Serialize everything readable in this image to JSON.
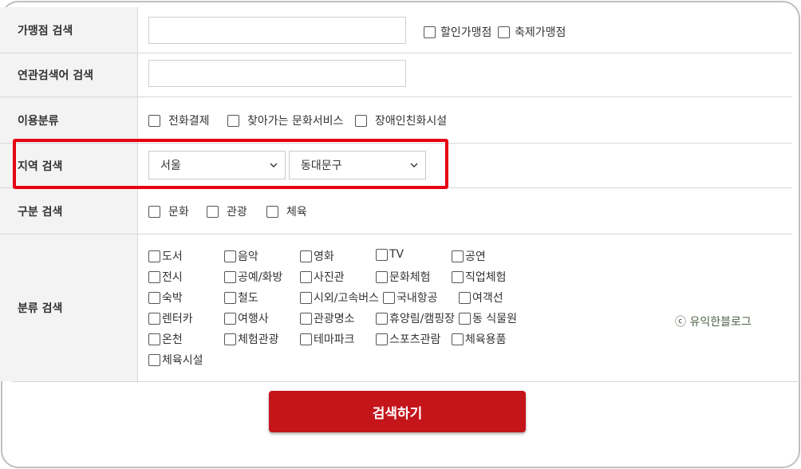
{
  "rows": {
    "merchant": {
      "label": "가맹점 검색",
      "checks": [
        "할인가맹점",
        "축제가맹점"
      ]
    },
    "keyword": {
      "label": "연관검색어 검색"
    },
    "usage": {
      "label": "이용분류",
      "checks": [
        "전화결제",
        "찾아가는 문화서비스",
        "장애인친화시설"
      ]
    },
    "region": {
      "label": "지역 검색",
      "city": "서울",
      "district": "동대문구"
    },
    "division": {
      "label": "구분 검색",
      "checks": [
        "문화",
        "관광",
        "체육"
      ]
    },
    "category": {
      "label": "분류 검색",
      "items": [
        "도서",
        "음악",
        "영화",
        "TV",
        "공연",
        "전시",
        "공예/화방",
        "사진관",
        "문화체험",
        "직업체험",
        "숙박",
        "철도",
        "시외/고속버스",
        "국내항공",
        "여객선",
        "렌터카",
        "여행사",
        "관광명소",
        "휴양림/캠핑장",
        "동 식물원",
        "온천",
        "체험관광",
        "테마파크",
        "스포츠관람",
        "체육용품",
        "체육시설"
      ]
    }
  },
  "watermark": "ⓒ 유익한블로그",
  "submit_label": "검색하기"
}
